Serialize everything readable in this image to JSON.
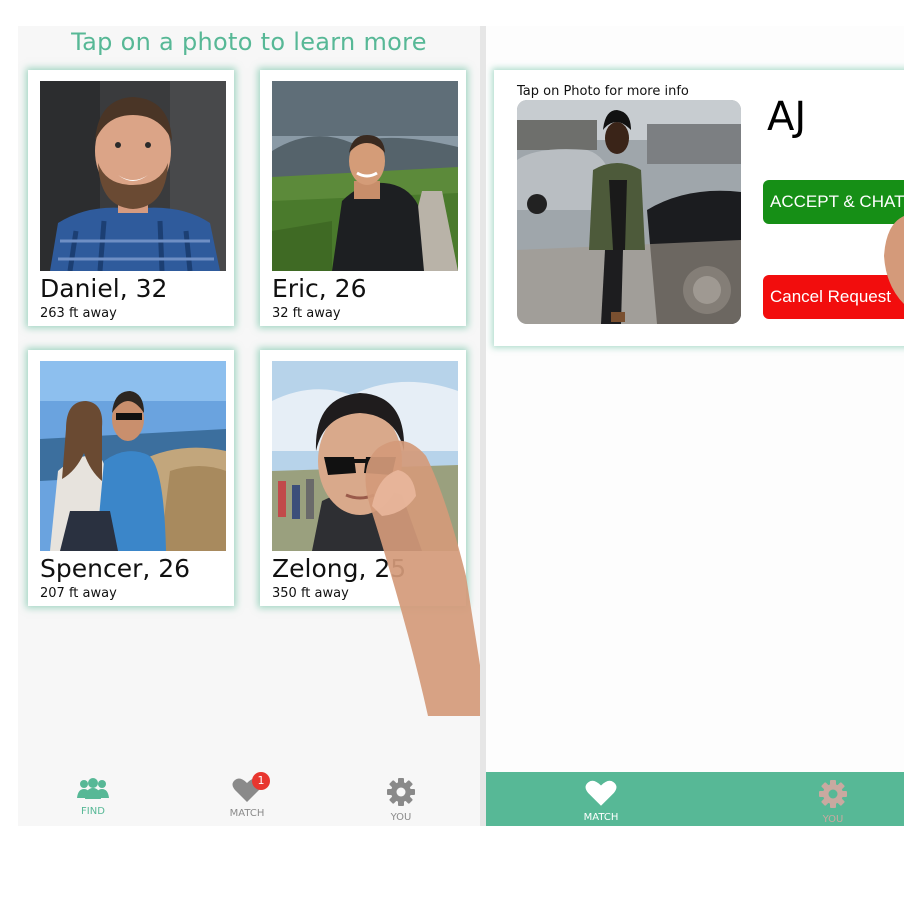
{
  "left_screen": {
    "headline": "Tap on a photo to learn more",
    "profiles": [
      {
        "name": "Daniel, 32",
        "distance": "263 ft away"
      },
      {
        "name": "Eric, 26",
        "distance": "32 ft away"
      },
      {
        "name": "Spencer, 26",
        "distance": "207 ft away"
      },
      {
        "name": "Zelong, 25",
        "distance": "350 ft away"
      }
    ],
    "tabbar": {
      "find_label": "FIND",
      "match_label": "MATCH",
      "match_badge": "1",
      "you_label": "YOU"
    }
  },
  "right_screen": {
    "request_card": {
      "hint": "Tap on Photo for more info",
      "name": "AJ",
      "accept_label": "ACCEPT & CHAT",
      "cancel_label": "Cancel Request"
    },
    "tabbar": {
      "match_label": "MATCH",
      "you_label": "YOU"
    }
  },
  "colors": {
    "accent": "#57b896",
    "accept": "#168f16",
    "cancel": "#f20d0d",
    "badge": "#e8362f",
    "tab_inactive": "#8a8a8a"
  },
  "icons": {
    "find": "people-group-icon",
    "match": "heart-icon",
    "you": "gear-icon"
  }
}
